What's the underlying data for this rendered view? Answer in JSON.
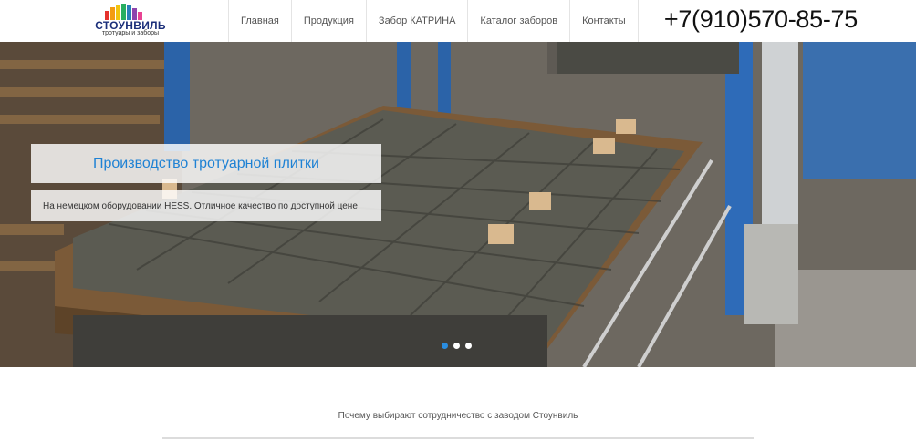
{
  "logo": {
    "title": "СТОУНВИЛЬ",
    "subtitle": "тротуары и заборы",
    "bar_colors": [
      "#e5322d",
      "#f39c12",
      "#f1c40f",
      "#27ae60",
      "#2980b9",
      "#8e44ad",
      "#e84393"
    ]
  },
  "nav": {
    "items": [
      {
        "label": "Главная"
      },
      {
        "label": "Продукция"
      },
      {
        "label": "Забор КАТРИНА"
      },
      {
        "label": "Каталог заборов"
      },
      {
        "label": "Контакты"
      }
    ]
  },
  "header": {
    "phone": "+7(910)570-85-75"
  },
  "slider": {
    "title": "Производство тротуарной плитки",
    "text": "На немецком оборудовании HESS. Отличное качество по доступной цене",
    "image": "factory-paving-stones-photo",
    "dots": 3,
    "active_dot": 1
  },
  "section": {
    "heading": "Почему выбирают сотрудничество с заводом Стоунвиль"
  },
  "colors": {
    "accent": "#1f82d4",
    "dot_active": "#2a8de0"
  }
}
